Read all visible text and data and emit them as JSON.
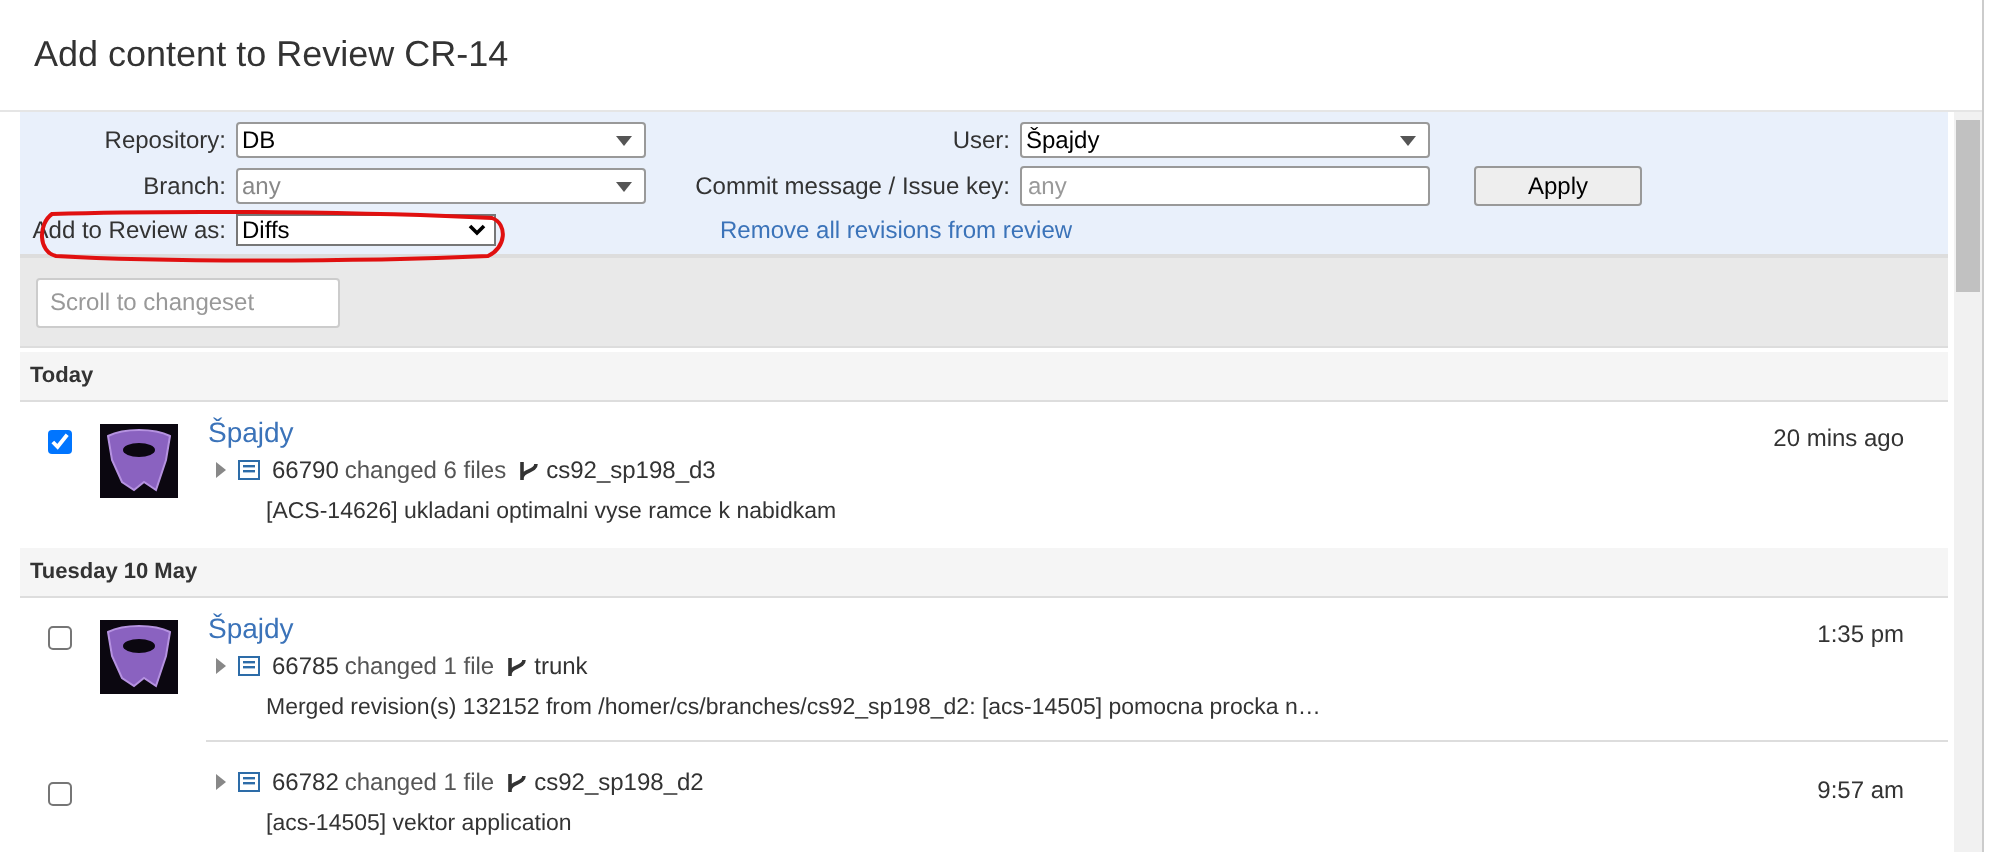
{
  "dialog": {
    "title": "Add content to Review CR-14"
  },
  "filters": {
    "repository": {
      "label": "Repository:",
      "value": "DB"
    },
    "branch": {
      "label": "Branch:",
      "placeholder": "any"
    },
    "add_as": {
      "label": "Add to Review as:",
      "value": "Diffs"
    },
    "user": {
      "label": "User:",
      "value": "Špajdy"
    },
    "commit": {
      "label": "Commit message / Issue key:",
      "placeholder": "any"
    },
    "apply_button": "Apply",
    "remove_link": "Remove all revisions from review"
  },
  "scroll_field": {
    "placeholder": "Scroll to changeset"
  },
  "groups": [
    {
      "date": "Today",
      "changesets": [
        {
          "selected": true,
          "author": "Špajdy",
          "revision": "66790",
          "files": "changed 6 files",
          "branch": "cs92_sp198_d3",
          "message": "[ACS-14626] ukladani optimalni vyse ramce k nabidkam",
          "time": "20 mins ago"
        }
      ]
    },
    {
      "date": "Tuesday 10 May",
      "changesets": [
        {
          "selected": false,
          "author": "Špajdy",
          "revision": "66785",
          "files": "changed 1 file",
          "branch": "trunk",
          "message": "Merged revision(s) 132152 from /homer/cs/branches/cs92_sp198_d2: [acs-14505] pomocna procka n…",
          "time": "1:35 pm"
        },
        {
          "selected": false,
          "revision": "66782",
          "files": "changed 1 file",
          "branch": "cs92_sp198_d2",
          "message": "[acs-14505] vektor application",
          "time": "9:57 am"
        }
      ]
    }
  ]
}
